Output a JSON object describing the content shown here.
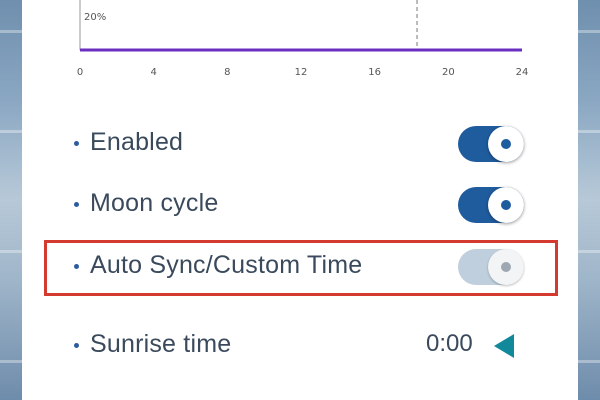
{
  "chart": {
    "y_tick": "20%",
    "x_ticks": [
      "0",
      "4",
      "8",
      "12",
      "16",
      "20",
      "24"
    ],
    "line_color": "#6a2fc0",
    "marker_hour": 18.3
  },
  "settings": {
    "enabled": {
      "label": "Enabled",
      "state": "on"
    },
    "moon_cycle": {
      "label": "Moon cycle",
      "state": "on"
    },
    "auto_sync": {
      "label": "Auto Sync/Custom Time",
      "state": "disabled"
    },
    "sunrise": {
      "label": "Sunrise time",
      "value": "0:00",
      "button_icon": "triangle-left-icon"
    }
  },
  "colors": {
    "toggle_on": "#1f5c9e",
    "highlight_border": "#d43b30",
    "triangle": "#12899a"
  }
}
